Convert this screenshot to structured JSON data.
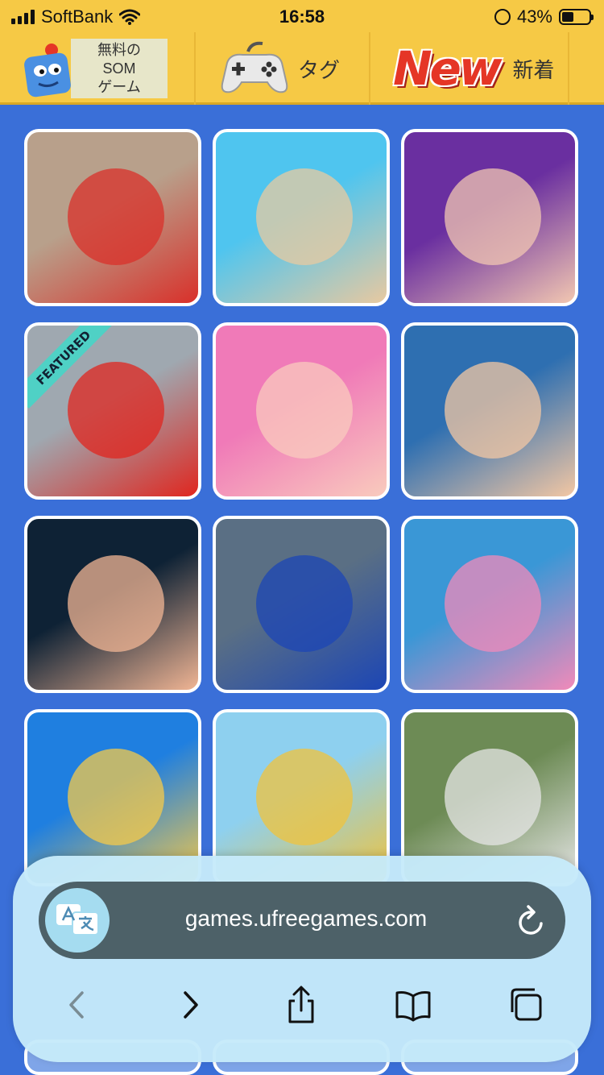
{
  "status_bar": {
    "carrier": "SoftBank",
    "time": "16:58",
    "battery": "43%",
    "battery_level": 0.43,
    "icons": [
      "signal-bars-icon",
      "wifi-icon",
      "alarm-icon",
      "battery-icon"
    ]
  },
  "nav": {
    "logo_label_line1": "無料の",
    "logo_label_line2": "SOM",
    "logo_label_line3": "ゲーム",
    "tag_label": "タグ",
    "new_badge": "New",
    "new_label": "新着",
    "icons": [
      "som-mascot-icon",
      "gamepad-icon"
    ]
  },
  "games": [
    {
      "name": "fruit-match-puzzle-thumbnail",
      "colors": [
        "#b8a08b",
        "#d9302a"
      ]
    },
    {
      "name": "hotel-money-thumbnail",
      "colors": [
        "#4fc5ef",
        "#e8c9a0"
      ]
    },
    {
      "name": "face-makeover-thumbnail",
      "colors": [
        "#6a2fa0",
        "#f2c7b1"
      ]
    },
    {
      "name": "stickman-shooter-thumbnail",
      "colors": [
        "#9fa8b0",
        "#e0261f"
      ]
    },
    {
      "name": "princess-makeup-thumbnail",
      "colors": [
        "#f07ab8",
        "#f9cbbd"
      ]
    },
    {
      "name": "baby-care-thumbnail",
      "colors": [
        "#2e6fb1",
        "#f3c7a3"
      ]
    },
    {
      "name": "cartoon-face-thumbnail",
      "colors": [
        "#0e2235",
        "#f1b594"
      ]
    },
    {
      "name": "motorbike-racer-thumbnail",
      "colors": [
        "#5a6f84",
        "#1c46b5"
      ]
    },
    {
      "name": "makeup-cosmetics-thumbnail",
      "colors": [
        "#3a97d6",
        "#f18ab9"
      ]
    },
    {
      "name": "pop-it-fidget-thumbnail",
      "colors": [
        "#1f7fe0",
        "#f5c94a"
      ]
    },
    {
      "name": "motocross-rider-thumbnail",
      "colors": [
        "#8ed0ef",
        "#f0c33c"
      ]
    },
    {
      "name": "highway-car-racing-thumbnail",
      "colors": [
        "#6d8b55",
        "#e6e6e6"
      ]
    }
  ],
  "featured_badge": "FEATURED",
  "browser": {
    "url": "games.ufreegames.com",
    "toolbar_icons": [
      "back-icon",
      "forward-icon",
      "share-icon",
      "bookmarks-icon",
      "tabs-icon"
    ],
    "accent": "#4d6168"
  }
}
